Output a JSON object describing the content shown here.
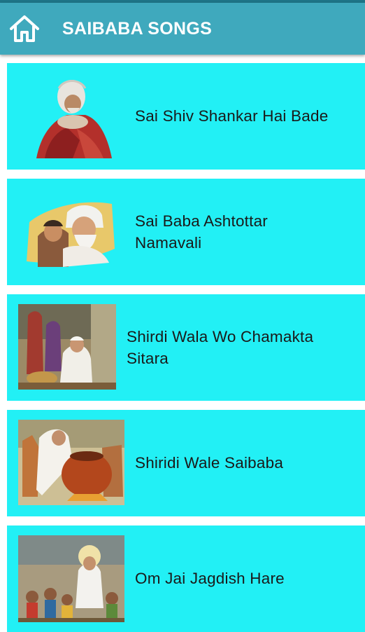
{
  "app": {
    "title": "SAIBABA SONGS",
    "home_icon": "home-icon"
  },
  "songs": [
    {
      "title": "Sai Shiv Shankar Hai Bade",
      "thumb": "saibaba-seated-thumbnail"
    },
    {
      "title": "Sai Baba Ashtottar Namavali",
      "thumb": "saibaba-with-child-thumbnail"
    },
    {
      "title": "Shirdi Wala Wo Chamakta Sitara",
      "thumb": "saibaba-village-scene-thumbnail"
    },
    {
      "title": "Shiridi Wale Saibaba",
      "thumb": "saibaba-cooking-pot-thumbnail"
    },
    {
      "title": "Om Jai Jagdish Hare",
      "thumb": "saibaba-with-children-thumbnail"
    }
  ],
  "colors": {
    "appbar": "#3fa9bd",
    "card": "#22f0f5",
    "text": "#1a1a1a"
  }
}
